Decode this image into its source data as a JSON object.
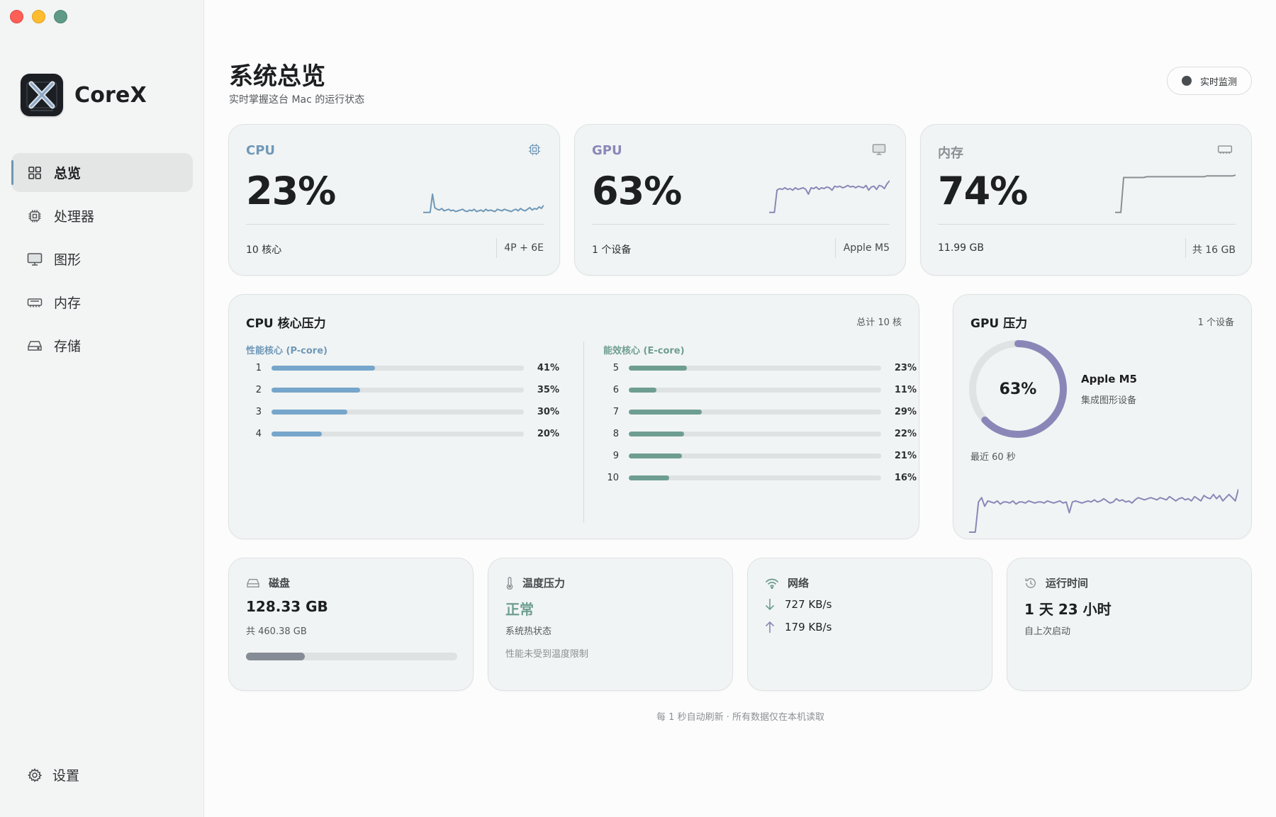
{
  "app": {
    "name": "CoreX"
  },
  "sidebar": {
    "items": [
      {
        "label": "总览",
        "icon": "grid-icon",
        "active": true
      },
      {
        "label": "处理器",
        "icon": "chip-icon"
      },
      {
        "label": "图形",
        "icon": "monitor-icon"
      },
      {
        "label": "内存",
        "icon": "memory-icon"
      },
      {
        "label": "存储",
        "icon": "drive-icon"
      }
    ],
    "settings_label": "设置"
  },
  "header": {
    "title": "系统总览",
    "subtitle": "实时掌握这台 Mac 的运行状态",
    "live_label": "实时监测"
  },
  "colors": {
    "cpu": "#6f98b8",
    "gpu": "#8a87b8",
    "memory": "#8b8f94",
    "ecore": "#6e9e91",
    "pcore": "#76a6cb"
  },
  "metrics": {
    "cpu": {
      "label": "CPU",
      "value": "23%",
      "foot_left": "10 核心",
      "foot_right": "4P + 6E",
      "spark": [
        2,
        2,
        2,
        2,
        25,
        8,
        6,
        5,
        7,
        4,
        5,
        6,
        4,
        5,
        3,
        4,
        5,
        6,
        4,
        3,
        5,
        4,
        6,
        3,
        4,
        5,
        3,
        6,
        4,
        5,
        4,
        3,
        6,
        5,
        4,
        6,
        5,
        4,
        3,
        5,
        6,
        4,
        7,
        5,
        4,
        6,
        8,
        5,
        7,
        6,
        9,
        7,
        11
      ]
    },
    "gpu": {
      "label": "GPU",
      "value": "63%",
      "foot_left": "1 个设备",
      "foot_right": "Apple M5",
      "spark": [
        2,
        2,
        2,
        30,
        32,
        31,
        33,
        31,
        32,
        30,
        33,
        31,
        32,
        33,
        31,
        25,
        33,
        32,
        34,
        31,
        33,
        32,
        34,
        33,
        30,
        35,
        34,
        35,
        33,
        34,
        36,
        34,
        35,
        33,
        35,
        34,
        33,
        36,
        30,
        34,
        35,
        31,
        36,
        35,
        32,
        38,
        42
      ]
    },
    "memory": {
      "label": "内存",
      "value": "74%",
      "foot_left": "11.99 GB",
      "foot_right": "共 16 GB",
      "spark": [
        2,
        2,
        2,
        46,
        46,
        46,
        46,
        46,
        46,
        46,
        46,
        47,
        47,
        47,
        47,
        47,
        47,
        47,
        47,
        47,
        47,
        47,
        47,
        47,
        47,
        47,
        47,
        47,
        47,
        47,
        47,
        47,
        48,
        48,
        48,
        48,
        48,
        48,
        48,
        48,
        48,
        48,
        49
      ]
    }
  },
  "cores": {
    "title": "CPU 核心压力",
    "total": "总计 10 核",
    "p_label": "性能核心 (P-core)",
    "e_label": "能效核心 (E-core)",
    "p": [
      {
        "id": "1",
        "pct": 41,
        "label": "41%"
      },
      {
        "id": "2",
        "pct": 35,
        "label": "35%"
      },
      {
        "id": "3",
        "pct": 30,
        "label": "30%"
      },
      {
        "id": "4",
        "pct": 20,
        "label": "20%"
      }
    ],
    "e": [
      {
        "id": "5",
        "pct": 23,
        "label": "23%"
      },
      {
        "id": "6",
        "pct": 11,
        "label": "11%"
      },
      {
        "id": "7",
        "pct": 29,
        "label": "29%"
      },
      {
        "id": "8",
        "pct": 22,
        "label": "22%"
      },
      {
        "id": "9",
        "pct": 21,
        "label": "21%"
      },
      {
        "id": "10",
        "pct": 16,
        "label": "16%"
      }
    ]
  },
  "gpu_pressure": {
    "title": "GPU 压力",
    "devices": "1 个设备",
    "value": "63%",
    "fraction": 0.63,
    "name": "Apple M5",
    "kind": "集成图形设备",
    "recent_label": "最近 60 秒",
    "spark": [
      2,
      2,
      2,
      30,
      34,
      26,
      31,
      30,
      29,
      31,
      28,
      30,
      30,
      29,
      31,
      28,
      30,
      30,
      29,
      31,
      30,
      29,
      30,
      30,
      29,
      31,
      30,
      29,
      30,
      31,
      29,
      30,
      20,
      30,
      31,
      30,
      29,
      30,
      31,
      30,
      32,
      30,
      31,
      33,
      31,
      29,
      30,
      33,
      31,
      32,
      30,
      31,
      29,
      32,
      34,
      33,
      32,
      33,
      34,
      33,
      32,
      34,
      33,
      32,
      35,
      33,
      31,
      33,
      34,
      32,
      33,
      31,
      35,
      33,
      31,
      36,
      34,
      33,
      37,
      33,
      36,
      31,
      34,
      37,
      34,
      31,
      42
    ]
  },
  "disk": {
    "label": "磁盘",
    "used": "128.33 GB",
    "total": "共 460.38 GB",
    "fraction": 0.279
  },
  "thermal": {
    "label": "温度压力",
    "status": "正常",
    "sub": "系统热状态",
    "note": "性能未受到温度限制"
  },
  "network": {
    "label": "网络",
    "down": "727 KB/s",
    "up": "179 KB/s"
  },
  "uptime": {
    "label": "运行时间",
    "value": "1 天 23 小时",
    "sub": "自上次启动"
  },
  "footer": "每 1 秒自动刷新 · 所有数据仅在本机读取"
}
